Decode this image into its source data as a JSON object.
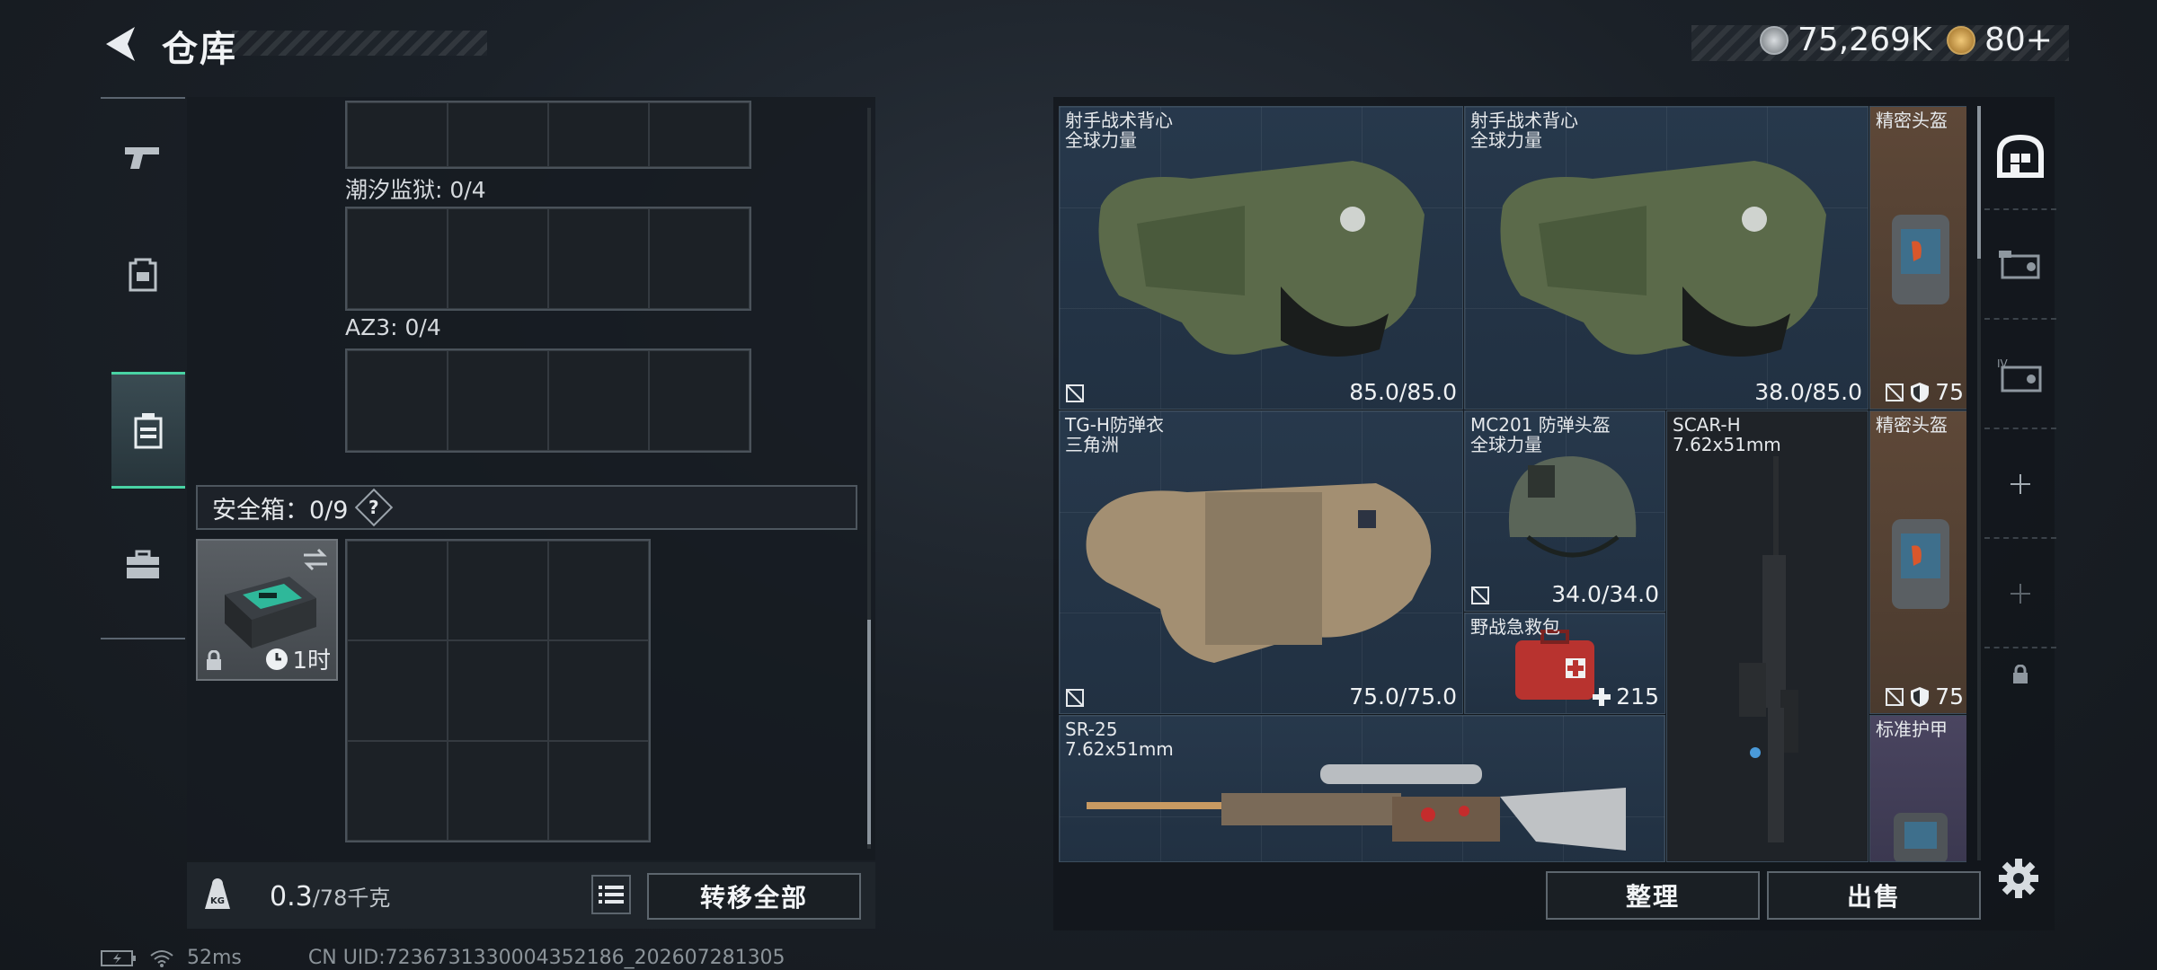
{
  "header": {
    "title": "仓库",
    "currency_1": "75,269K",
    "currency_2": "80+"
  },
  "categories": [
    {
      "name": "weapons",
      "icon": "pistol-icon"
    },
    {
      "name": "equipment",
      "icon": "backpack-icon"
    },
    {
      "name": "containers",
      "icon": "case-icon",
      "active": true
    },
    {
      "name": "items",
      "icon": "toolbox-icon"
    }
  ],
  "left_panel": {
    "section_1": "潮汐监狱: 0/4",
    "section_2": "AZ3: 0/4",
    "safebox_label": "安全箱：0/9",
    "safebox_help": "?",
    "safebox_timer": "1时",
    "weight_value": "0.3",
    "weight_max": "/78千克",
    "transfer_all": "转移全部"
  },
  "stash": [
    {
      "name": "射手战术背心",
      "sub": "全球力量",
      "durability": "85.0/85.0"
    },
    {
      "name": "射手战术背心",
      "sub": "全球力量",
      "durability": "38.0/85.0"
    },
    {
      "name": "精密头盔",
      "armor": "75"
    },
    {
      "name": "TG-H防弹衣",
      "sub": "三角洲",
      "durability": "75.0/75.0"
    },
    {
      "name": "MC201 防弹头盔",
      "sub": "全球力量",
      "durability": "34.0/34.0"
    },
    {
      "name": "SCAR-H",
      "sub": "7.62x51mm"
    },
    {
      "name": "精密头盔",
      "armor": "75"
    },
    {
      "name": "野战急救包",
      "count": "215"
    },
    {
      "name": "SR-25",
      "sub": "7.62x51mm"
    },
    {
      "name": "标准护甲"
    }
  ],
  "actions": {
    "sort": "整理",
    "sell": "出售"
  },
  "status": {
    "ping": "52ms",
    "uid": "CN UID:7236731330004352186_202607281305"
  },
  "colors": {
    "accent": "#49d3a4",
    "cell_blue": "#283a4e",
    "cell_brown": "#5e4838",
    "cell_purple": "#4a4560"
  }
}
